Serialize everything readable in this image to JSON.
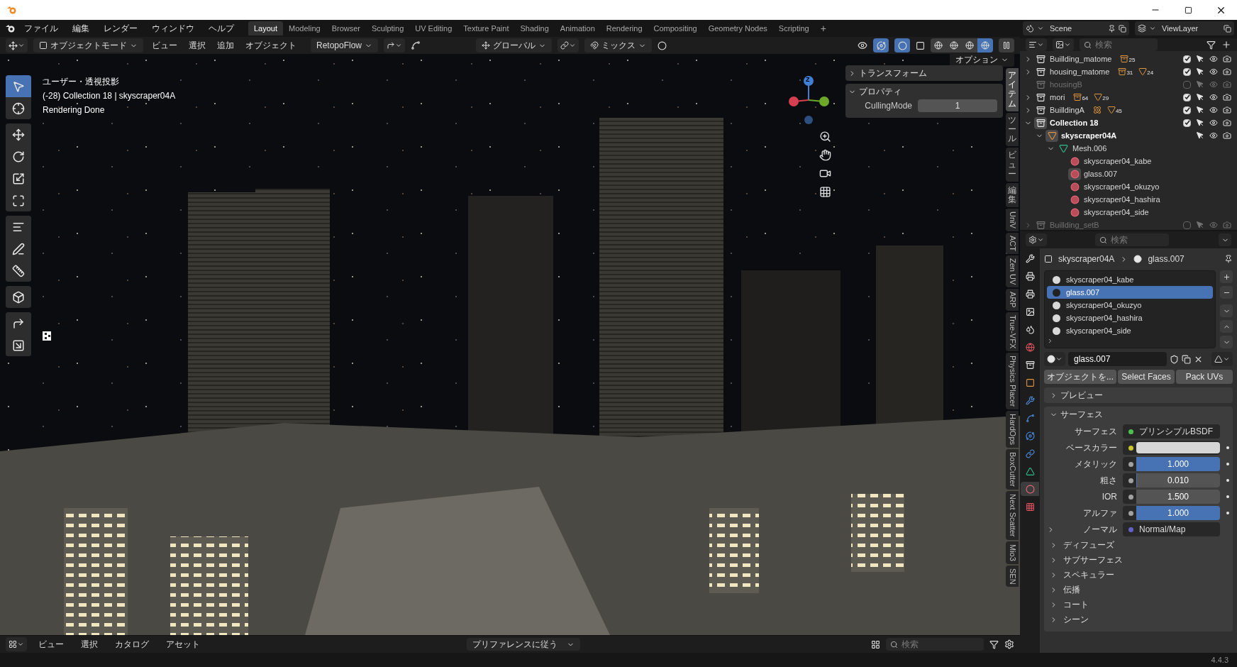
{
  "menu": [
    "ファイル",
    "編集",
    "レンダー",
    "ウィンドウ",
    "ヘルプ"
  ],
  "workspaces": [
    {
      "label": "Layout",
      "selected": true
    },
    {
      "label": "Modeling",
      "selected": false
    },
    {
      "label": "Browser",
      "selected": false
    },
    {
      "label": "Sculpting",
      "selected": false
    },
    {
      "label": "UV Editing",
      "selected": false
    },
    {
      "label": "Texture Paint",
      "selected": false
    },
    {
      "label": "Shading",
      "selected": false
    },
    {
      "label": "Animation",
      "selected": false
    },
    {
      "label": "Rendering",
      "selected": false
    },
    {
      "label": "Compositing",
      "selected": false
    },
    {
      "label": "Geometry Nodes",
      "selected": false
    },
    {
      "label": "Scripting",
      "selected": false
    }
  ],
  "add_workspace": "+",
  "scene": "Scene",
  "view_layer": "ViewLayer",
  "viewport_header": {
    "mode": "オブジェクトモード",
    "menus": [
      "ビュー",
      "選択",
      "追加",
      "オブジェクト"
    ],
    "addon": "RetopoFlow",
    "orientation": "グローバル",
    "snap_target": "ミックス",
    "shading": [
      {
        "selected": false
      },
      {
        "selected": false
      },
      {
        "selected": false
      },
      {
        "selected": true
      }
    ]
  },
  "viewport": {
    "overlay_lines": [
      "ユーザー・透視投影",
      "(-28) Collection 18 | skyscraper04A",
      "Rendering Done"
    ],
    "options": "オプション",
    "gizmo_axis": "Z",
    "toolbar": [
      {
        "tools": [
          {
            "selected": true
          },
          {
            "selected": false
          }
        ]
      },
      {
        "tools": [
          {
            "selected": false
          },
          {
            "selected": false
          },
          {
            "selected": false
          },
          {
            "selected": false
          }
        ]
      },
      {
        "tools": [
          {
            "selected": false
          },
          {
            "selected": false
          },
          {
            "selected": false
          }
        ]
      },
      {
        "tools": [
          {
            "selected": false
          }
        ]
      },
      {
        "tools": [
          {
            "selected": false
          },
          {
            "selected": false
          }
        ]
      }
    ],
    "sidebar_panels": [
      {
        "title": "トランスフォーム",
        "expanded": false
      },
      {
        "title": "プロパティ",
        "expanded": true,
        "fields": [
          {
            "label": "CullingMode",
            "value": "1"
          }
        ]
      }
    ],
    "side_tabs": [
      {
        "label": "アイテム",
        "kind": "cjk",
        "selected": true
      },
      {
        "label": "ツール",
        "kind": "cjk",
        "selected": false
      },
      {
        "label": "ビュー",
        "kind": "cjk",
        "selected": false
      },
      {
        "label": "編集",
        "kind": "cjk",
        "selected": false
      },
      {
        "label": "UniV",
        "kind": "latin",
        "selected": false
      },
      {
        "label": "ACT",
        "kind": "latin",
        "selected": false
      },
      {
        "label": "Zen UV",
        "kind": "latin",
        "selected": false
      },
      {
        "label": "ARP",
        "kind": "latin",
        "selected": false
      },
      {
        "label": "True-VFX",
        "kind": "latin",
        "selected": false
      },
      {
        "label": "Physics Placer",
        "kind": "latin",
        "selected": false
      },
      {
        "label": "HardOps",
        "kind": "latin",
        "selected": false
      },
      {
        "label": "BoxCutter",
        "kind": "latin",
        "selected": false
      },
      {
        "label": "Next Scatter",
        "kind": "latin",
        "selected": false
      },
      {
        "label": "Mio3",
        "kind": "latin",
        "selected": false
      },
      {
        "label": "SEN",
        "kind": "latin",
        "selected": false
      }
    ]
  },
  "asset_bar": {
    "menus": [
      "ビュー",
      "選択",
      "カタログ",
      "アセット"
    ],
    "import_method": "プリファレンスに従う",
    "search_placeholder": "検索"
  },
  "outliner": {
    "search_placeholder": "検索",
    "items": [
      {
        "name": "Buillding_matome",
        "kind": "collection",
        "expanded": false,
        "checked": true,
        "active": false,
        "badges": [
          {
            "kind": "collection",
            "count": "25"
          }
        ]
      },
      {
        "name": "housing_matome",
        "kind": "collection",
        "expanded": false,
        "checked": true,
        "active": false,
        "badges": [
          {
            "kind": "collection",
            "count": "31"
          },
          {
            "kind": "mesh",
            "count": "24"
          }
        ]
      },
      {
        "name": "housingB",
        "kind": "collection",
        "checked": false,
        "disabled": true,
        "active": false
      },
      {
        "name": "mori",
        "kind": "collection",
        "expanded": false,
        "checked": true,
        "active": false,
        "badges": [
          {
            "kind": "collection",
            "count": "64"
          },
          {
            "kind": "mesh",
            "count": "29"
          }
        ]
      },
      {
        "name": "BuilldingA",
        "kind": "collection",
        "expanded": false,
        "checked": true,
        "active": false,
        "badges": [
          {
            "kind": "empty"
          },
          {
            "kind": "mesh",
            "count": "45"
          }
        ]
      },
      {
        "name": "Collection 18",
        "kind": "collection",
        "expanded": true,
        "checked": true,
        "active": true,
        "children": [
          {
            "name": "skyscraper04A",
            "kind": "object",
            "expanded": true,
            "active": true,
            "children": [
              {
                "name": "Mesh.006",
                "kind": "mesh",
                "expanded": true,
                "active": false,
                "children": [
                  {
                    "name": "skyscraper04_kabe",
                    "kind": "material",
                    "active": false
                  },
                  {
                    "name": "glass.007",
                    "kind": "material",
                    "active": true
                  },
                  {
                    "name": "skyscraper04_okuzyo",
                    "kind": "material",
                    "active": false
                  },
                  {
                    "name": "skyscraper04_hashira",
                    "kind": "material",
                    "active": false
                  },
                  {
                    "name": "skyscraper04_side",
                    "kind": "material",
                    "active": false
                  }
                ]
              }
            ]
          }
        ]
      },
      {
        "name": "Buillding_setB",
        "kind": "collection",
        "expanded": false,
        "checked": false,
        "disabled": true,
        "active": false
      }
    ]
  },
  "properties": {
    "search_placeholder": "検索",
    "tabs": [
      {
        "selected": false
      },
      {
        "selected": false
      },
      {
        "selected": false
      },
      {
        "selected": false
      },
      {
        "selected": false
      },
      {
        "selected": false
      },
      {
        "selected": false
      },
      {
        "selected": false
      },
      {
        "selected": false
      },
      {
        "selected": false
      },
      {
        "selected": false
      },
      {
        "selected": false
      },
      {
        "selected": false
      },
      {
        "selected": true
      },
      {
        "selected": false
      }
    ],
    "breadcrumb": [
      "skyscraper04A",
      "glass.007"
    ],
    "slots": [
      {
        "name": "skyscraper04_kabe",
        "selected": false
      },
      {
        "name": "glass.007",
        "selected": true
      },
      {
        "name": "skyscraper04_okuzyo",
        "selected": false
      },
      {
        "name": "skyscraper04_hashira",
        "selected": false
      },
      {
        "name": "skyscraper04_side",
        "selected": false
      }
    ],
    "material_name": "glass.007",
    "buttons": [
      "オブジェクトを...",
      "Select Faces",
      "Pack UVs"
    ],
    "preview": {
      "title": "プレビュー",
      "expanded": false
    },
    "surface": {
      "title": "サーフェス",
      "expanded": true,
      "rows": [
        {
          "label": "サーフェス",
          "kind": "shader",
          "color": "#4cc44c",
          "value": "プリンシプルBSDF"
        },
        {
          "label": "ベースカラー",
          "kind": "swatch",
          "color": "#c7c729"
        },
        {
          "label": "メタリック",
          "kind": "slider",
          "color": "#a1a1a1",
          "value": "1.000",
          "level": 1
        },
        {
          "label": "粗さ",
          "kind": "slider",
          "color": "#a1a1a1",
          "value": "0.010",
          "level": 0.01
        },
        {
          "label": "IOR",
          "kind": "number",
          "color": "#a1a1a1",
          "value": "1.500"
        },
        {
          "label": "アルファ",
          "kind": "slider",
          "color": "#a1a1a1",
          "value": "1.000",
          "level": 1
        },
        {
          "label": "ノーマル",
          "kind": "link",
          "color": "#6363c7",
          "value": "Normal/Map"
        }
      ]
    },
    "subpanels": [
      "ディフューズ",
      "サブサーフェス",
      "スペキュラー",
      "伝播",
      "コート",
      "シーン"
    ]
  },
  "version": "4.4.3"
}
